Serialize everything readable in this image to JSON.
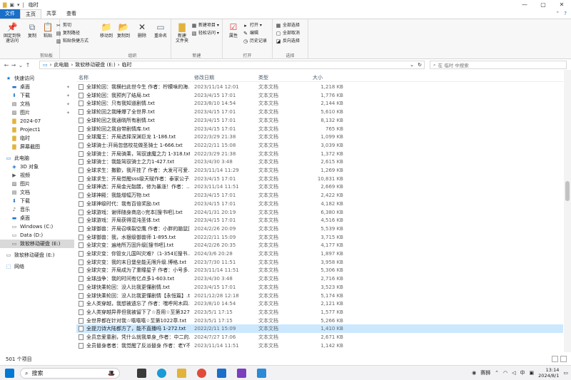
{
  "window": {
    "title": "临时",
    "minimize": "—",
    "maximize": "▢",
    "close": "✕"
  },
  "tabs": [
    "文件",
    "主页",
    "共享",
    "查看"
  ],
  "ribbon": {
    "clipboard": {
      "label": "剪贴板",
      "pin": "固定到快\n速访问",
      "copy": "复制",
      "paste": "粘贴",
      "cut": "剪切",
      "copy_path": "复制路径",
      "paste_shortcut": "粘贴快捷方式"
    },
    "organize": {
      "label": "组织",
      "move_to": "移动到",
      "copy_to": "复制到",
      "delete": "删除",
      "rename": "重命名"
    },
    "new": {
      "label": "新建",
      "new_folder": "新建\n文件夹",
      "new_item": "新建项目 ▾",
      "easy_access": "轻松访问 ▾"
    },
    "open": {
      "label": "打开",
      "properties": "属性",
      "open": "打开 ▾",
      "edit": "编辑",
      "history": "历史记录"
    },
    "select": {
      "label": "选择",
      "select_all": "全部选择",
      "select_none": "全部取消",
      "invert": "反向选择"
    }
  },
  "address": {
    "path": [
      "此电脑",
      "致软移动硬盘 (E:)",
      "临时"
    ],
    "search_placeholder": "在 临时 中搜索"
  },
  "nav": [
    {
      "label": "快速访问",
      "icon": "star-icon",
      "level": 0,
      "pin": false
    },
    {
      "label": "桌面",
      "icon": "desktop-icon",
      "level": 1,
      "pin": true
    },
    {
      "label": "下载",
      "icon": "download-icon",
      "level": 1,
      "pin": true
    },
    {
      "label": "文档",
      "icon": "document-icon",
      "level": 1,
      "pin": true
    },
    {
      "label": "图片",
      "icon": "picture-icon",
      "level": 1,
      "pin": true
    },
    {
      "label": "2024-07",
      "icon": "folder-icon",
      "level": 1,
      "pin": false
    },
    {
      "label": "Project1",
      "icon": "folder-icon",
      "level": 1,
      "pin": false
    },
    {
      "label": "临时",
      "icon": "folder-icon",
      "level": 1,
      "pin": false
    },
    {
      "label": "屏幕截图",
      "icon": "folder-icon",
      "level": 1,
      "pin": false
    },
    {
      "label": "",
      "icon": "",
      "level": 0,
      "pin": false
    },
    {
      "label": "此电脑",
      "icon": "computer-icon",
      "level": 0,
      "pin": false
    },
    {
      "label": "3D 对象",
      "icon": "cube-icon",
      "level": 1,
      "pin": false
    },
    {
      "label": "视频",
      "icon": "video-icon",
      "level": 1,
      "pin": false
    },
    {
      "label": "图片",
      "icon": "picture-icon",
      "level": 1,
      "pin": false
    },
    {
      "label": "文档",
      "icon": "document-icon",
      "level": 1,
      "pin": false
    },
    {
      "label": "下载",
      "icon": "download-icon",
      "level": 1,
      "pin": false
    },
    {
      "label": "音乐",
      "icon": "music-icon",
      "level": 1,
      "pin": false
    },
    {
      "label": "桌面",
      "icon": "desktop-icon",
      "level": 1,
      "pin": false
    },
    {
      "label": "Windows (C:)",
      "icon": "drive-icon",
      "level": 1,
      "pin": false
    },
    {
      "label": "Data (D:)",
      "icon": "drive-icon",
      "level": 1,
      "pin": false
    },
    {
      "label": "致软移动硬盘 (E:)",
      "icon": "drive-icon",
      "level": 1,
      "pin": false,
      "selected": true
    },
    {
      "label": "",
      "icon": "",
      "level": 0,
      "pin": false
    },
    {
      "label": "致软移动硬盘 (E:)",
      "icon": "drive-icon",
      "level": 0,
      "pin": false
    },
    {
      "label": "",
      "icon": "",
      "level": 0,
      "pin": false
    },
    {
      "label": "网络",
      "icon": "network-icon",
      "level": 0,
      "pin": false
    }
  ],
  "columns": {
    "name": "名称",
    "date": "修改日期",
    "type": "类型",
    "size": "大小"
  },
  "files": [
    {
      "name": "全球轮回：我横扫此世今生 作者：柠檬味的海...",
      "date": "2023/11/14 12:01",
      "type": "文本文档",
      "size": "1,218 KB"
    },
    {
      "name": "全球轮回：我预判了结局.txt",
      "date": "2023/4/15 17:01",
      "type": "文本文档",
      "size": "1,776 KB"
    },
    {
      "name": "全球轮回：只有我知道剧情.txt",
      "date": "2023/8/10 14:54",
      "type": "文本文档",
      "size": "2,144 KB"
    },
    {
      "name": "全球轮回之我睡爆了全世界.txt",
      "date": "2023/4/15 17:01",
      "type": "文本文档",
      "size": "5,610 KB"
    },
    {
      "name": "全球轮回之我通晓所有剧情.txt",
      "date": "2023/4/15 17:01",
      "type": "文本文档",
      "size": "8,132 KB"
    },
    {
      "name": "全球轮回之我自带剧情库.txt",
      "date": "2023/4/15 17:01",
      "type": "文本文档",
      "size": "765 KB"
    },
    {
      "name": "全球魔王：开局选择深渊巨龙 1-186.txt",
      "date": "2022/3/29 21:38",
      "type": "文本文档",
      "size": "1,099 KB"
    },
    {
      "name": "全球骑士:开局忽悠校花做圣骑士 1-666.txt",
      "date": "2022/2/11 15:08",
      "type": "文本文档",
      "size": "3,039 KB"
    },
    {
      "name": "全球骑士：开局骑乘，驾驭速魔之力 1-318.txt",
      "date": "2022/3/29 21:38",
      "type": "文本文档",
      "size": "1,372 KB"
    },
    {
      "name": "全球骑士：我能驾驭骑士之力1-427.txt",
      "date": "2023/4/30 3:48",
      "type": "文本文档",
      "size": "2,615 KB"
    },
    {
      "name": "全球求生：撒歡，我开挂了 作者：大发可可爱...",
      "date": "2023/11/14 11:29",
      "type": "文本文档",
      "size": "1,269 KB"
    },
    {
      "name": "全球求生：开局觉醒sss级天赋作者：泰家公子.t...",
      "date": "2023/4/15 17:01",
      "type": "文本文档",
      "size": "10,831 KB"
    },
    {
      "name": "全球神选：开局金光骷髅，修为暴涨！作者：...",
      "date": "2023/11/14 11:51",
      "type": "文本文档",
      "size": "2,669 KB"
    },
    {
      "name": "全球神殿：我能增幅万物.txt",
      "date": "2023/4/15 17:01",
      "type": "文本文档",
      "size": "2,422 KB"
    },
    {
      "name": "全球神级时代：我有百倍奖励.txt",
      "date": "2023/4/15 17:01",
      "type": "文本文档",
      "size": "4,182 KB"
    },
    {
      "name": "全球游戏：谢师随身商店◇完本[搜书吧].txt",
      "date": "2024/1/31 20:19",
      "type": "文本文档",
      "size": "6,380 KB"
    },
    {
      "name": "全球游戏：开局获得混沌圣体.txt",
      "date": "2023/4/15 17:01",
      "type": "文本文档",
      "size": "4,516 KB"
    },
    {
      "name": "全球御兽：开局召唤裂空鹰 作者：小胖的脑鼠[...",
      "date": "2024/2/26 20:09",
      "type": "文本文档",
      "size": "5,539 KB"
    },
    {
      "name": "全球御兽：我，水银级御兽师 1-895.txt",
      "date": "2022/2/11 15:09",
      "type": "文本文档",
      "size": "3,715 KB"
    },
    {
      "name": "全球灾变：遍地所万固升级[搜书吧].txt",
      "date": "2024/2/26 20:35",
      "type": "文本文档",
      "size": "4,177 KB"
    },
    {
      "name": "全球灾变：你管女儿国叫灾难?（1-354)[搜书...",
      "date": "2024/3/6 20:28",
      "type": "文本文档",
      "size": "1,897 KB"
    },
    {
      "name": "全球灾变：我的末日堡垒能无限升级.博格.txt",
      "date": "2023/7/30 11:51",
      "type": "文本文档",
      "size": "3,958 KB"
    },
    {
      "name": "全球灾变：开局成为了重瞳星子 作者：小号多...",
      "date": "2023/11/14 11:51",
      "type": "文本文档",
      "size": "5,306 KB"
    },
    {
      "name": "全球战争：我的时间有亿点多1-603.txt",
      "date": "2023/4/30 3:48",
      "type": "文本文档",
      "size": "2,716 KB"
    },
    {
      "name": "全球快乘轮回：没人比我更懂剧情.txt",
      "date": "2023/4/15 17:01",
      "type": "文本文档",
      "size": "3,523 KB"
    },
    {
      "name": "全球快乘轮回：没人比我更懂剧情【永恒篇】.txt",
      "date": "2021/12/28 12:18",
      "type": "文本文档",
      "size": "5,174 KB"
    },
    {
      "name": "全人类穿越，我想被遗忘了 作者：嘿呼阿木四.t...",
      "date": "2023/8/10 14:54",
      "type": "文本文档",
      "size": "2,121 KB"
    },
    {
      "name": "全人类穿越异界但我被留下了☆吾用☆至第327...",
      "date": "2023/5/1 17:15",
      "type": "文本文档",
      "size": "1,577 KB"
    },
    {
      "name": "全世界都在针对我☆嘻嘻嘻☆至第1022章.txt",
      "date": "2023/5/1 17:15",
      "type": "文本文档",
      "size": "5,266 KB"
    },
    {
      "name": "全提刀诗大陆都方了，能不直播吗 1-272.txt",
      "date": "2022/2/11 15:09",
      "type": "文本文档",
      "size": "1,410 KB",
      "selected": true
    },
    {
      "name": "全员恋爱童剧，凭什么就我单身_作者：中二的...",
      "date": "2024/7/27 17:06",
      "type": "文本文档",
      "size": "2,671 KB"
    },
    {
      "name": "全员替身者者：我觉醒了反派替身 作者：老Y不...",
      "date": "2023/11/14 11:51",
      "type": "文本文档",
      "size": "1,142 KB"
    }
  ],
  "status": {
    "count": "501 个项目"
  },
  "taskbar": {
    "search_label": "搜索",
    "weather": "赛狮",
    "ime": "中",
    "time": "13:14",
    "date": "2024/8/1"
  }
}
